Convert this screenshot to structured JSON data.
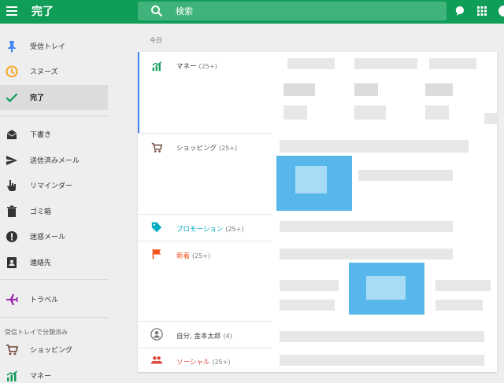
{
  "header": {
    "title": "完了",
    "search_placeholder": "検索"
  },
  "sidebar": {
    "items": [
      {
        "label": "受信トレイ"
      },
      {
        "label": "スヌーズ"
      },
      {
        "label": "完了"
      },
      {
        "label": "下書き"
      },
      {
        "label": "送信済みメール"
      },
      {
        "label": "リマインダー"
      },
      {
        "label": "ゴミ箱"
      },
      {
        "label": "迷惑メール"
      },
      {
        "label": "連絡先"
      },
      {
        "label": "トラベル"
      },
      {
        "label": "ショッピング"
      },
      {
        "label": "マネー"
      }
    ],
    "section_label": "受信トレイで分類済み"
  },
  "main": {
    "date_label": "今日",
    "bundles": [
      {
        "label": "マネー",
        "count": "(25+)"
      },
      {
        "label": "ショッピング",
        "count": "(25+)"
      },
      {
        "label": "プロモーション",
        "count": "(25+)"
      },
      {
        "label": "新着",
        "count": "(25+)"
      },
      {
        "label": "自分, 金本太郎",
        "count": "(4)"
      },
      {
        "label": "ソーシャル",
        "count": "(25+)"
      }
    ]
  },
  "colors": {
    "header": "#0f9d58",
    "money": "#0f9d58",
    "shopping": "#795548",
    "promotions": "#00acc1",
    "updates": "#f4511e",
    "social": "#db4437",
    "travel": "#9c27b0",
    "selection": "#4285f4"
  },
  "icons": {
    "menu": "menu-icon",
    "search": "search-icon",
    "chat": "chat-bubble-icon",
    "apps": "apps-grid-icon",
    "inbox": "pin-icon",
    "snooze": "clock-icon",
    "done": "check-icon",
    "drafts": "drafts-icon",
    "sent": "send-icon",
    "reminders": "hand-pointer-icon",
    "trash": "trash-icon",
    "spam": "alert-icon",
    "contacts": "contacts-icon",
    "travel": "airplane-icon",
    "shopping": "cart-icon",
    "money": "bar-chart-icon",
    "promotions": "tag-icon",
    "updates": "flag-icon",
    "person": "person-icon",
    "social": "people-icon"
  }
}
